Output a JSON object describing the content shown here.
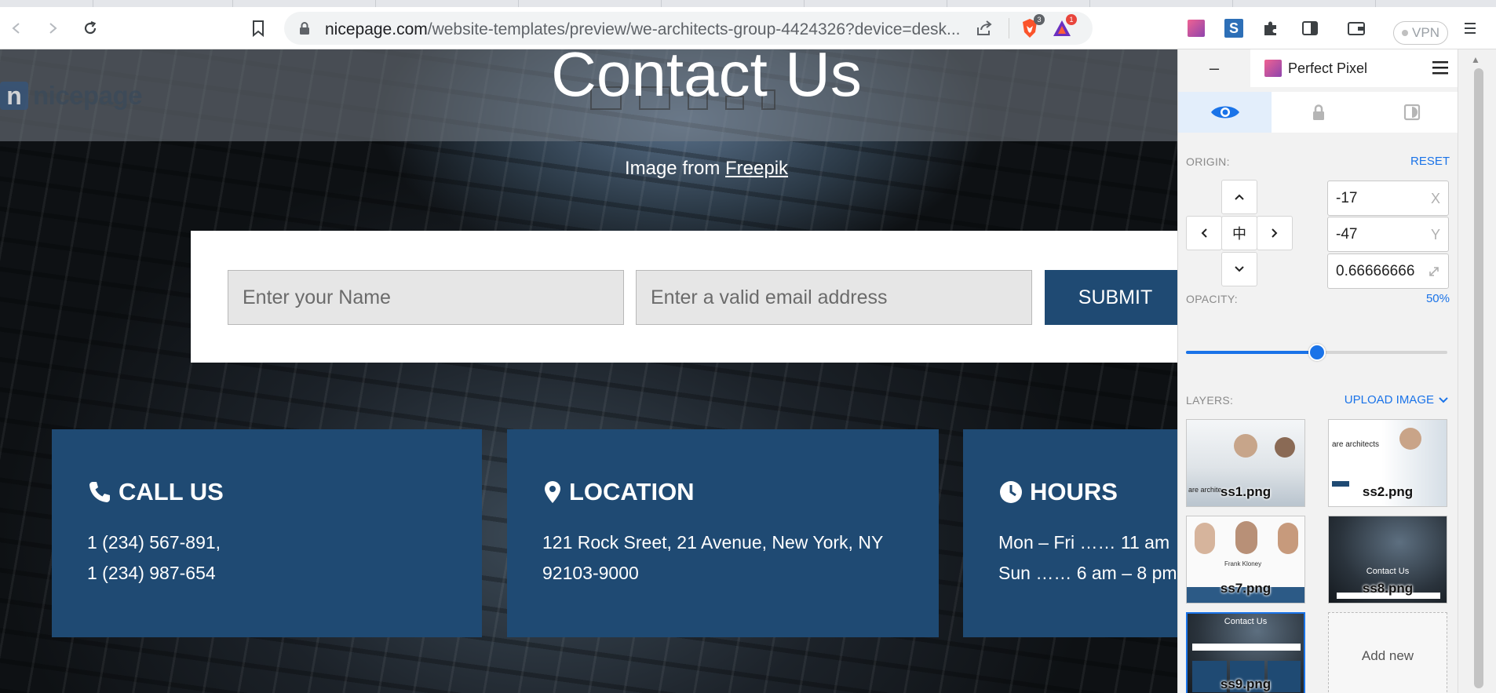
{
  "browser": {
    "url_host": "nicepage.com",
    "url_path": "/website-templates/preview/we-architects-group-4424326?device=desk...",
    "brave_badge": "3",
    "alert_badge": "1",
    "vpn_label": "VPN"
  },
  "page": {
    "heading": "Contact Us",
    "logo_text": "nicepage",
    "logo_mark": "n",
    "credit_prefix": "Image from",
    "credit_link": "Freepik",
    "form": {
      "name_placeholder": "Enter your Name",
      "email_placeholder": "Enter a valid email address",
      "submit_label": "SUBMIT"
    },
    "cards": [
      {
        "title": "CALL US",
        "icon": "phone-icon",
        "lines": [
          "1 (234) 567-891,",
          "1 (234) 987-654"
        ]
      },
      {
        "title": "LOCATION",
        "icon": "map-pin-icon",
        "lines": [
          "121 Rock Sreet, 21 Avenue, New York, NY",
          "92103-9000"
        ]
      },
      {
        "title": "HOURS",
        "icon": "clock-icon",
        "lines": [
          "Mon – Fri …… 11 am",
          "Sun  …… 6 am – 8 pm"
        ]
      }
    ],
    "accent_color": "#1f4a73"
  },
  "perfect_pixel": {
    "title": "Perfect Pixel",
    "minimize": "–",
    "origin_label": "ORIGIN:",
    "reset_label": "RESET",
    "x_value": "-17",
    "x_unit": "X",
    "y_value": "-47",
    "y_unit": "Y",
    "scale_value": "0.66666666",
    "center_glyph": "中",
    "opacity_label": "OPACITY:",
    "opacity_value": "50%",
    "opacity_fraction": 0.5,
    "layers_label": "LAYERS:",
    "upload_label": "UPLOAD IMAGE",
    "layers": [
      {
        "name": "ss1.png",
        "caption": "are archite"
      },
      {
        "name": "ss2.png",
        "caption": "are architects"
      },
      {
        "name": "ss7.png",
        "caption": "Frank Kloney"
      },
      {
        "name": "ss8.png",
        "caption": "Contact Us"
      },
      {
        "name": "ss9.png",
        "caption": "Contact Us"
      }
    ],
    "add_new_label": "Add new"
  }
}
